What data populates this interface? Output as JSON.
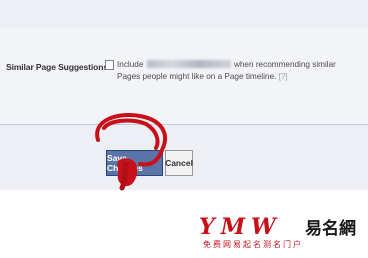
{
  "settings": {
    "row_label": "Similar Page Suggestions",
    "checkbox_checked": false,
    "description_prefix": "Include",
    "description_suffix": "when recommending similar Pages people might like on a Page timeline.",
    "help_marker": "[?]"
  },
  "actions": {
    "save_label": "Save Changes",
    "cancel_label": "Cancel"
  },
  "annotation": {
    "color": "#c8101a"
  },
  "watermark": {
    "latin_text": "YMW",
    "cjk_text": "易名網",
    "tagline": "免费网易起名测名门户"
  }
}
